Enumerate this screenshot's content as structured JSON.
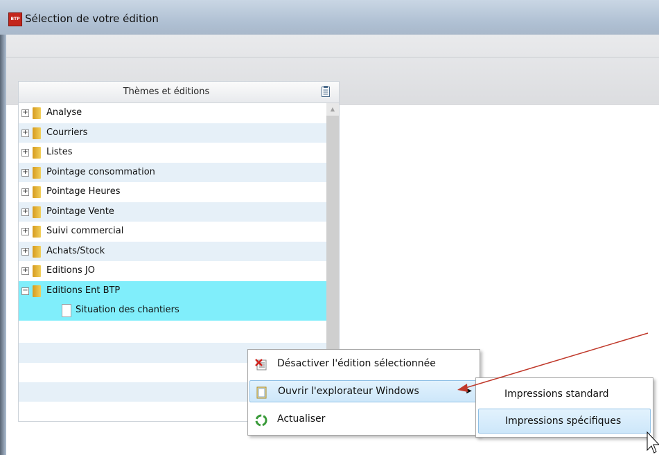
{
  "window": {
    "title": "Sélection de votre édition",
    "icon": "app-logo-icon",
    "icon_text": "BTP"
  },
  "tree": {
    "header": "Thèmes et éditions",
    "header_icon": "clipboard-icon",
    "items": [
      {
        "label": "Analyse",
        "expander": "+"
      },
      {
        "label": "Courriers",
        "expander": "+"
      },
      {
        "label": "Listes",
        "expander": "+"
      },
      {
        "label": "Pointage consommation",
        "expander": "+"
      },
      {
        "label": "Pointage Heures",
        "expander": "+"
      },
      {
        "label": "Pointage Vente",
        "expander": "+"
      },
      {
        "label": "Suivi commercial",
        "expander": "+"
      },
      {
        "label": "Achats/Stock",
        "expander": "+"
      },
      {
        "label": "Editions JO",
        "expander": "+"
      },
      {
        "label": "Editions Ent BTP",
        "expander": "−",
        "expanded": true
      }
    ],
    "child": {
      "label": "Situation des chantiers"
    }
  },
  "context_menu": {
    "items": [
      {
        "label": "Désactiver l'édition sélectionnée",
        "icon": "disable-icon"
      },
      {
        "label": "Ouvrir l'explorateur Windows",
        "icon": "folder-open-icon",
        "has_submenu": true
      },
      {
        "label": "Actualiser",
        "icon": "refresh-icon"
      }
    ]
  },
  "submenu": {
    "items": [
      {
        "label": "Impressions standard"
      },
      {
        "label": "Impressions spécifiques",
        "highlighted": true
      }
    ]
  },
  "colors": {
    "selection": "#80eefb",
    "annotation_arrow": "#c0392b",
    "menu_hover": "#cde7fa"
  }
}
